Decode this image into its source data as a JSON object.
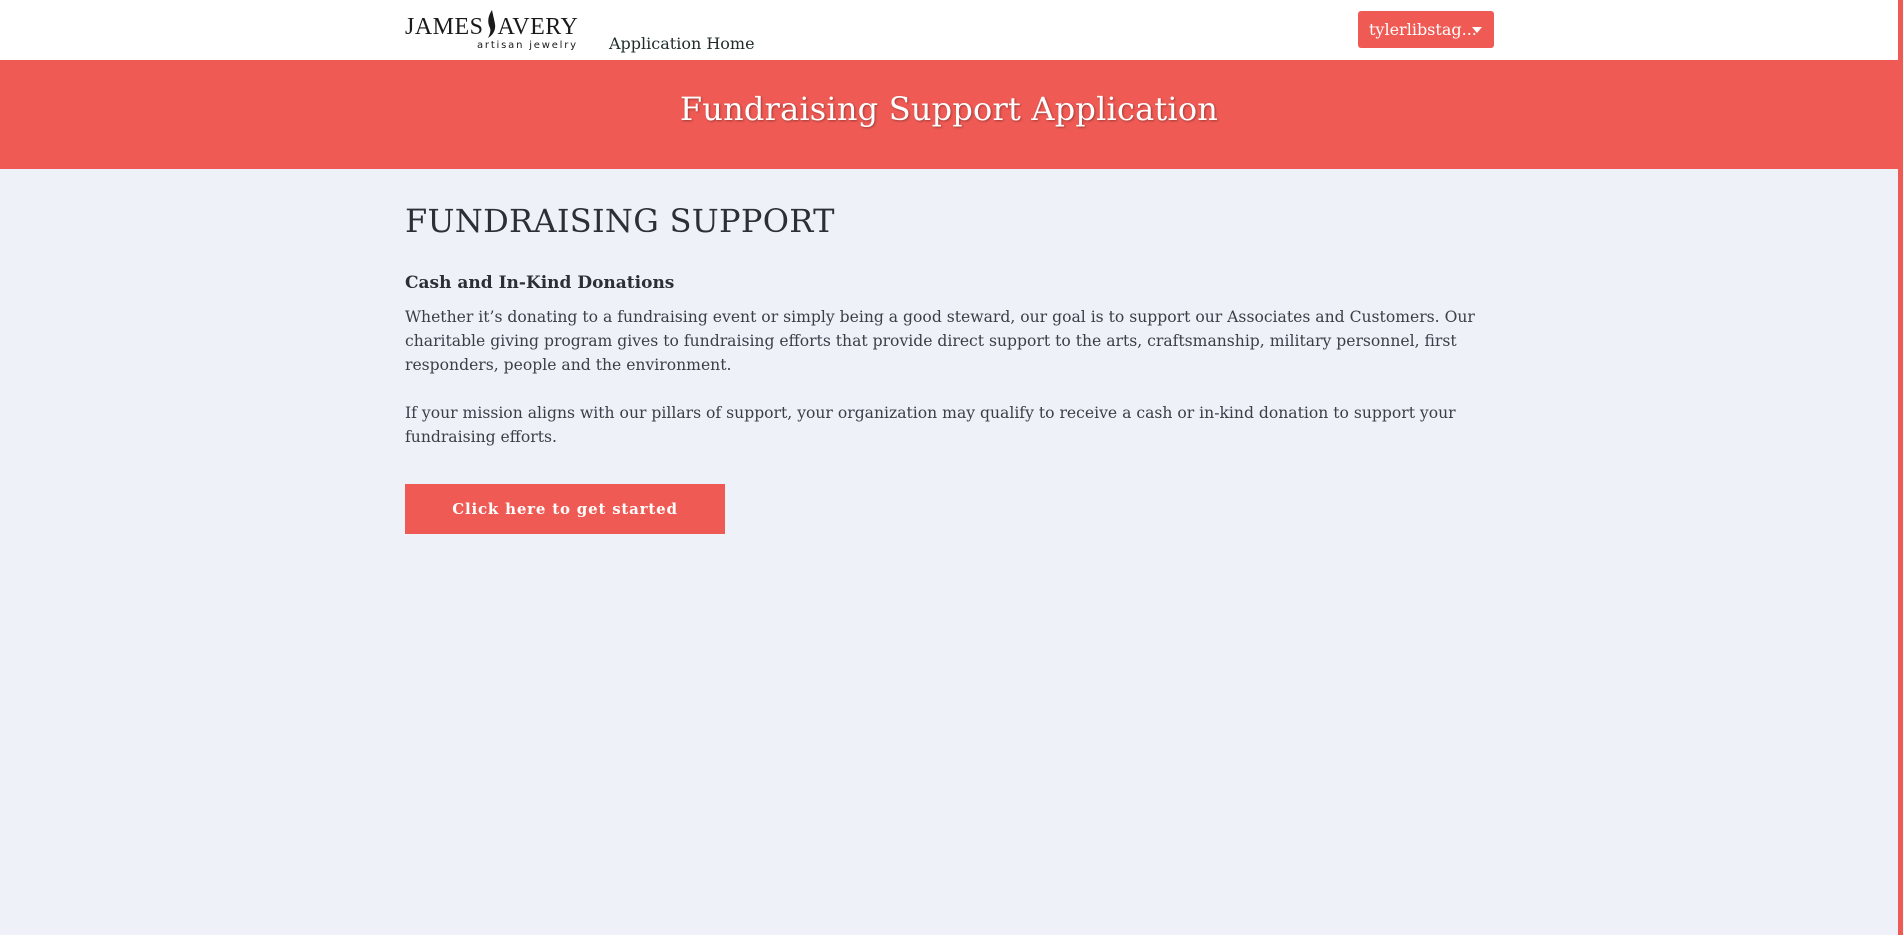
{
  "header": {
    "logo": {
      "brand": "JAMES AVERY",
      "brand_word_1": "JAMES",
      "brand_word_2": "AVERY",
      "tagline": "artisan jewelry"
    },
    "nav": {
      "home_label": "Application Home"
    },
    "user_menu": {
      "username": "tylerlibstag..."
    }
  },
  "banner": {
    "title": "Fundraising Support Application"
  },
  "main": {
    "heading": "FUNDRAISING SUPPORT",
    "subheading": "Cash and In-Kind Donations",
    "paragraph_1": "Whether it’s donating to a fundraising event or simply being a good steward, our goal is to support our Associates and Customers. Our charitable giving program gives to fundraising efforts that provide direct support to the arts, craftsmanship, military personnel, first responders, people and the environment.",
    "paragraph_2": "If your mission aligns with our pillars of support, your organization may qualify to receive a cash or in-kind donation to support your fundraising efforts.",
    "cta_label": "Click here to get started"
  },
  "colors": {
    "accent": "#f05a54",
    "page_background": "#eff1f8",
    "header_background": "#ffffff",
    "text": "#2b3036"
  },
  "icons": {
    "logo_mark": "flame-icon",
    "user_menu_caret": "caret-down-icon"
  }
}
